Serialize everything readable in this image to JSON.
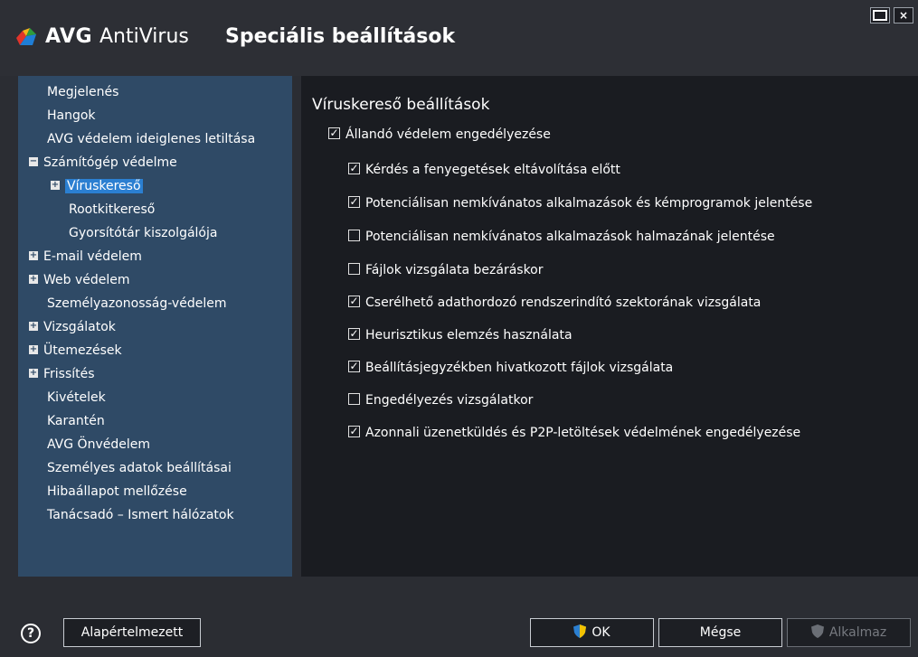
{
  "titlebar": {
    "brand": "AVG",
    "product": "AntiVirus",
    "title": "Speciális beállítások"
  },
  "window_controls": {
    "close": "×"
  },
  "sidebar": {
    "items": [
      {
        "label": "Megjelenés",
        "expander": ""
      },
      {
        "label": "Hangok",
        "expander": ""
      },
      {
        "label": "AVG védelem ideiglenes letiltása",
        "expander": ""
      },
      {
        "label": "Számítógép védelme",
        "expander": "−"
      },
      {
        "label": "Víruskereső",
        "expander": "+",
        "selected": true
      },
      {
        "label": "Rootkitkereső",
        "expander": ""
      },
      {
        "label": "Gyorsítótár kiszolgálója",
        "expander": ""
      },
      {
        "label": "E-mail védelem",
        "expander": "+"
      },
      {
        "label": "Web védelem",
        "expander": "+"
      },
      {
        "label": "Személyazonosság-védelem",
        "expander": ""
      },
      {
        "label": "Vizsgálatok",
        "expander": "+"
      },
      {
        "label": "Ütemezések",
        "expander": "+"
      },
      {
        "label": "Frissítés",
        "expander": "+"
      },
      {
        "label": "Kivételek",
        "expander": ""
      },
      {
        "label": "Karantén",
        "expander": ""
      },
      {
        "label": "AVG Önvédelem",
        "expander": ""
      },
      {
        "label": "Személyes adatok beállításai",
        "expander": ""
      },
      {
        "label": "Hibaállapot mellőzése",
        "expander": ""
      },
      {
        "label": "Tanácsadó – Ismert hálózatok",
        "expander": ""
      }
    ]
  },
  "main": {
    "section_title": "Víruskereső beállítások",
    "options": [
      {
        "label": "Állandó védelem engedélyezése",
        "checked": true
      },
      {
        "label": "Kérdés a fenyegetések eltávolítása előtt",
        "checked": true
      },
      {
        "label": "Potenciálisan nemkívánatos alkalmazások és kémprogramok jelentése",
        "checked": true
      },
      {
        "label": "Potenciálisan nemkívánatos alkalmazások halmazának jelentése",
        "checked": false
      },
      {
        "label": "Fájlok vizsgálata bezáráskor",
        "checked": false
      },
      {
        "label": "Cserélhető adathordozó rendszerindító szektorának vizsgálata",
        "checked": true
      },
      {
        "label": "Heurisztikus elemzés használata",
        "checked": true
      },
      {
        "label": "Beállításjegyzékben hivatkozott fájlok vizsgálata",
        "checked": true
      },
      {
        "label": "Engedélyezés vizsgálatkor",
        "checked": false
      },
      {
        "label": "Azonnali üzenetküldés és P2P-letöltések védelmének engedélyezése",
        "checked": true
      }
    ]
  },
  "footer": {
    "help": "?",
    "default_button": "Alapértelmezett",
    "ok_button": "OK",
    "cancel_button": "Mégse",
    "apply_button": "Alkalmaz"
  }
}
